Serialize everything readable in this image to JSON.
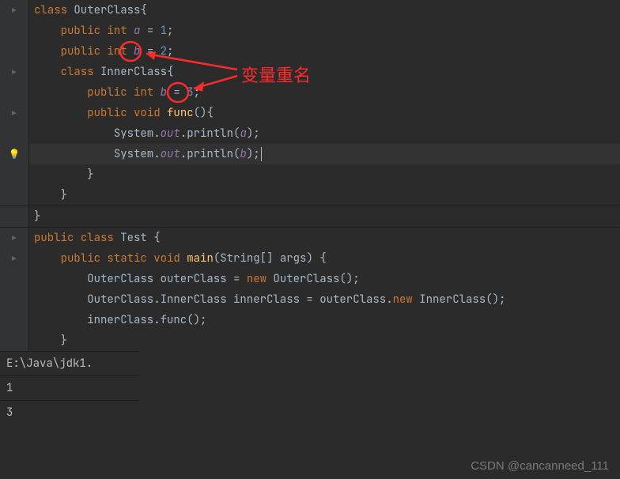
{
  "annotation": {
    "label": "变量重名"
  },
  "code": {
    "l1": {
      "kw1": "class",
      "cls": "OuterClass",
      "brace": "{"
    },
    "l2": {
      "kw": "public",
      "ty": "int",
      "id": "a",
      "eq": " = ",
      "val": "1",
      "sc": ";"
    },
    "l3": {
      "kw": "public",
      "ty": "int",
      "id": "b",
      "eq": " = ",
      "val": "2",
      "sc": ";"
    },
    "l4": {
      "kw": "class",
      "cls": "InnerClass",
      "brace": "{"
    },
    "l5": {
      "kw": "public",
      "ty": "int",
      "id": "b",
      "eq": " = ",
      "val": "3",
      "sc": ";"
    },
    "l6": {
      "kw": "public",
      "ty": "void",
      "fn": "func",
      "rest": "(){"
    },
    "l7": {
      "obj": "System.",
      "out": "out",
      "call": ".println(",
      "arg": "a",
      "end": ");"
    },
    "l8": {
      "obj": "System.",
      "out": "out",
      "call": ".println(",
      "arg": "b",
      "end": ");"
    },
    "l9": {
      "brace": "}"
    },
    "l10": {
      "brace": "}"
    },
    "l11": {
      "brace": "}"
    },
    "l12": {
      "kw": "public",
      "kw2": "class",
      "cls": "Test",
      "brace": " {"
    },
    "l13": {
      "kw": "public",
      "kw2": "static",
      "ty": "void",
      "fn": "main",
      "args": "(String[] args) {"
    },
    "l14": {
      "ty": "OuterClass",
      "var": " outerClass = ",
      "kw": "new",
      "call": " OuterClass();"
    },
    "l15": {
      "ty": "OuterClass.InnerClass",
      "var": " innerClass = outerClass.",
      "kw": "new",
      "call": " InnerClass();"
    },
    "l16": {
      "call": "innerClass.func();"
    },
    "l17": {
      "brace": "}"
    }
  },
  "console": {
    "path": "E:\\Java\\jdk1.",
    "out1": "1",
    "out2": "3"
  },
  "watermark": "CSDN @cancanneed_111"
}
